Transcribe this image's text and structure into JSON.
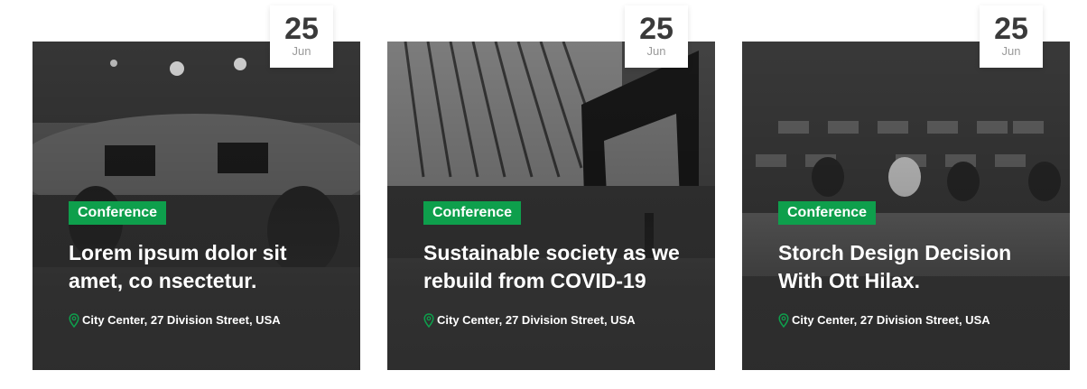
{
  "events": [
    {
      "day": "25",
      "month": "Jun",
      "category": "Conference",
      "title": "Lorem ipsum dolor sit amet, co nsectetur.",
      "location": "City Center, 27 Division Street, USA"
    },
    {
      "day": "25",
      "month": "Jun",
      "category": "Conference",
      "title": "Sustainable society as we rebuild from COVID-19",
      "location": "City Center, 27 Division Street, USA"
    },
    {
      "day": "25",
      "month": "Jun",
      "category": "Conference",
      "title": "Storch Design Decision With Ott Hilax.",
      "location": "City Center, 27 Division Street, USA"
    }
  ],
  "colors": {
    "badge_green": "#0e9f4c",
    "pin_green": "#0e9f4c",
    "date_text": "#3a3a3a",
    "month_text": "#9a9a9a"
  }
}
